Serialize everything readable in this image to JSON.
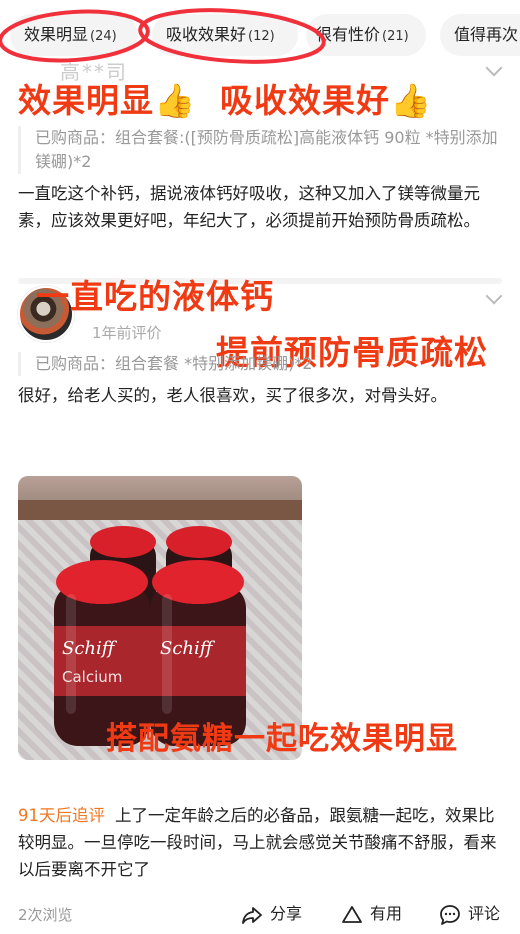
{
  "tabs": [
    {
      "label": "效果明显",
      "count": "(24)"
    },
    {
      "label": "吸收效果好",
      "count": "(12)"
    },
    {
      "label": "很有性价",
      "count": "(21)"
    },
    {
      "label": "值得再次",
      "count": ""
    }
  ],
  "overlays": {
    "top_left": "效果明显👍",
    "top_right": "吸收效果好👍",
    "middle_1": "一直吃的液体钙",
    "middle_2": "提前预防骨质疏松",
    "photo_caption": "搭配氨糖一起吃效果明显"
  },
  "review1": {
    "username_faded": "高**司",
    "purchased": "已购商品：组合套餐:([预防骨质疏松]高能液体钙 90粒 *特别添加镁硼)*2",
    "text": "一直吃这个补钙，据说液体钙好吸收，这种又加入了镁等微量元素，应该效果更好吧，年纪大了，必须提前开始预防骨质疏松。"
  },
  "review2": {
    "time": "1年前评价",
    "purchased": "已购商品：组合套餐 *特别添加镁硼)*2",
    "text": "很好，给老人买的，老人很喜欢，买了很多次，对骨头好。",
    "photo_label": "Schiff",
    "photo_label2": "Calcium",
    "followup_tag": "91天后追评",
    "followup_text": "上了一定年龄之后的必备品，跟氨糖一起吃，效果比较明显。一旦停吃一段时间，马上就会感觉关节酸痛不舒服，看来以后要离不开它了"
  },
  "footer": {
    "views": "2次浏览",
    "share": "分享",
    "useful": "有用",
    "comment": "评论"
  },
  "colors": {
    "overlay": "#f03a14",
    "followup": "#f07722",
    "scribble": "#f0303a"
  }
}
